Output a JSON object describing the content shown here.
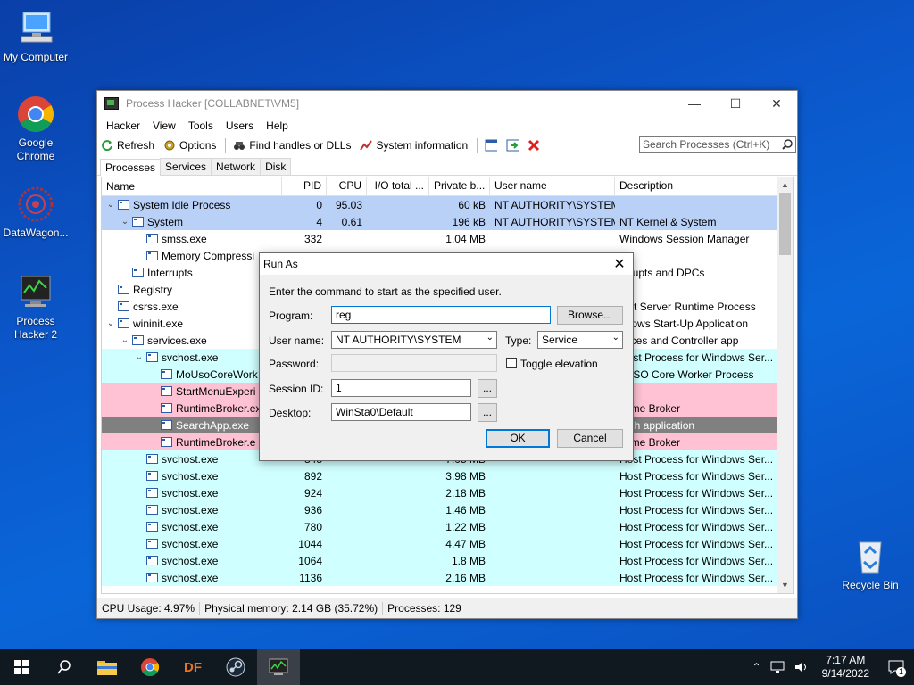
{
  "desktop": {
    "icons": [
      {
        "label": "My Computer"
      },
      {
        "label": "Google Chrome"
      },
      {
        "label": "DataWagon..."
      },
      {
        "label": "Process Hacker 2"
      },
      {
        "label": "Recycle Bin"
      }
    ]
  },
  "window": {
    "title": "Process Hacker [COLLABNET\\VM5]",
    "menu": [
      "Hacker",
      "View",
      "Tools",
      "Users",
      "Help"
    ],
    "toolbar": {
      "refresh": "Refresh",
      "options": "Options",
      "find_handles": "Find handles or DLLs",
      "system_info": "System information"
    },
    "search_placeholder": "Search Processes (Ctrl+K)",
    "tabs": [
      "Processes",
      "Services",
      "Network",
      "Disk"
    ],
    "columns": [
      "Name",
      "PID",
      "CPU",
      "I/O total ...",
      "Private b...",
      "User name",
      "Description"
    ],
    "rows": [
      {
        "name": "System Idle Process",
        "pid": "0",
        "cpu": "95.03",
        "io": "",
        "priv": "60 kB",
        "user": "NT AUTHORITY\\SYSTEM",
        "desc": ""
      },
      {
        "name": "System",
        "pid": "4",
        "cpu": "0.61",
        "io": "",
        "priv": "196 kB",
        "user": "NT AUTHORITY\\SYSTEM",
        "desc": "NT Kernel & System"
      },
      {
        "name": "smss.exe",
        "pid": "332",
        "cpu": "",
        "io": "",
        "priv": "1.04 MB",
        "user": "",
        "desc": "Windows Session Manager"
      },
      {
        "name": "Memory Compressi",
        "pid": "",
        "cpu": "",
        "io": "",
        "priv": "",
        "user": "",
        "desc": ""
      },
      {
        "name": "Interrupts",
        "pid": "",
        "cpu": "",
        "io": "",
        "priv": "",
        "user": "",
        "desc": "errupts and DPCs"
      },
      {
        "name": "Registry",
        "pid": "",
        "cpu": "",
        "io": "",
        "priv": "",
        "user": "",
        "desc": ""
      },
      {
        "name": "csrss.exe",
        "pid": "",
        "cpu": "",
        "io": "",
        "priv": "",
        "user": "",
        "desc": "ient Server Runtime Process"
      },
      {
        "name": "wininit.exe",
        "pid": "",
        "cpu": "",
        "io": "",
        "priv": "",
        "user": "",
        "desc": "ndows Start-Up Application"
      },
      {
        "name": "services.exe",
        "pid": "",
        "cpu": "",
        "io": "",
        "priv": "",
        "user": "",
        "desc": "rvices and Controller app"
      },
      {
        "name": "svchost.exe",
        "pid": "",
        "cpu": "",
        "io": "",
        "priv": "",
        "user": "",
        "desc": "Host Process for Windows Ser..."
      },
      {
        "name": "MoUsoCoreWork",
        "pid": "",
        "cpu": "",
        "io": "",
        "priv": "",
        "user": "",
        "desc": "oUSO Core Worker Process"
      },
      {
        "name": "StartMenuExperi",
        "pid": "",
        "cpu": "",
        "io": "",
        "priv": "",
        "user": "",
        "desc": ""
      },
      {
        "name": "RuntimeBroker.ex",
        "pid": "",
        "cpu": "",
        "io": "",
        "priv": "",
        "user": "",
        "desc": "ntime Broker"
      },
      {
        "name": "SearchApp.exe",
        "pid": "",
        "cpu": "",
        "io": "",
        "priv": "",
        "user": "",
        "desc": "arch application"
      },
      {
        "name": "RuntimeBroker.e",
        "pid": "",
        "cpu": "",
        "io": "",
        "priv": "",
        "user": "",
        "desc": "ntime Broker"
      },
      {
        "name": "svchost.exe",
        "pid": "848",
        "cpu": "",
        "io": "",
        "priv": "7.05 MB",
        "user": "",
        "desc": "Host Process for Windows Ser..."
      },
      {
        "name": "svchost.exe",
        "pid": "892",
        "cpu": "",
        "io": "",
        "priv": "3.98 MB",
        "user": "",
        "desc": "Host Process for Windows Ser..."
      },
      {
        "name": "svchost.exe",
        "pid": "924",
        "cpu": "",
        "io": "",
        "priv": "2.18 MB",
        "user": "",
        "desc": "Host Process for Windows Ser..."
      },
      {
        "name": "svchost.exe",
        "pid": "936",
        "cpu": "",
        "io": "",
        "priv": "1.46 MB",
        "user": "",
        "desc": "Host Process for Windows Ser..."
      },
      {
        "name": "svchost.exe",
        "pid": "780",
        "cpu": "",
        "io": "",
        "priv": "1.22 MB",
        "user": "",
        "desc": "Host Process for Windows Ser..."
      },
      {
        "name": "svchost.exe",
        "pid": "1044",
        "cpu": "",
        "io": "",
        "priv": "4.47 MB",
        "user": "",
        "desc": "Host Process for Windows Ser..."
      },
      {
        "name": "svchost.exe",
        "pid": "1064",
        "cpu": "",
        "io": "",
        "priv": "1.8 MB",
        "user": "",
        "desc": "Host Process for Windows Ser..."
      },
      {
        "name": "svchost.exe",
        "pid": "1136",
        "cpu": "",
        "io": "",
        "priv": "2.16 MB",
        "user": "",
        "desc": "Host Process for Windows Ser..."
      }
    ],
    "status": {
      "cpu": "CPU Usage: 4.97%",
      "memory": "Physical memory: 2.14 GB (35.72%)",
      "processes": "Processes: 129"
    }
  },
  "dialog": {
    "title": "Run As",
    "instruction": "Enter the command to start as the specified user.",
    "program_label": "Program:",
    "program_value": "reg",
    "browse": "Browse...",
    "username_label": "User name:",
    "username_value": "NT AUTHORITY\\SYSTEM",
    "type_label": "Type:",
    "type_value": "Service",
    "password_label": "Password:",
    "toggle_elevation": "Toggle elevation",
    "session_label": "Session ID:",
    "session_value": "1",
    "desktop_label": "Desktop:",
    "desktop_value": "WinSta0\\Default",
    "ellipsis": "...",
    "ok": "OK",
    "cancel": "Cancel"
  },
  "taskbar": {
    "apps": [
      "start",
      "search",
      "file-explorer",
      "chrome",
      "DF",
      "steam",
      "process-hacker"
    ],
    "df_label": "DF",
    "time": "7:17 AM",
    "date": "9/14/2022",
    "notif_count": "1"
  },
  "colors": {
    "desktop_bg": "#0b56c9",
    "system_row": "#b9d0f7",
    "service_row": "#d0ffff",
    "suspended_row": "#ffc2d4",
    "selected_row": "#808080",
    "accent": "#0078d7"
  }
}
